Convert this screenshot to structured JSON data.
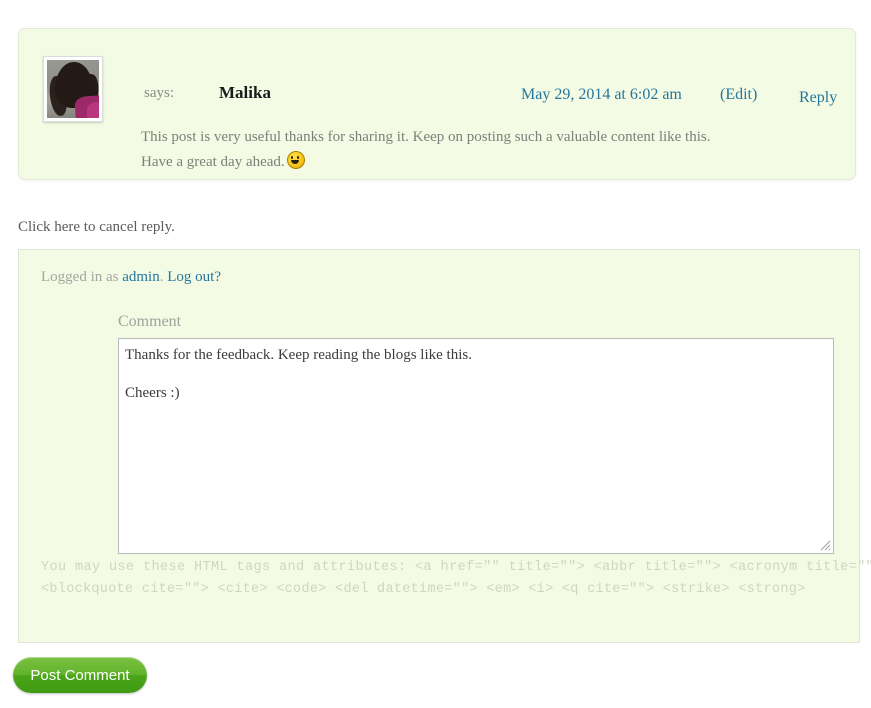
{
  "comment": {
    "says_label": "says:",
    "author": "Malika",
    "date": "May 29, 2014 at 6:02 am",
    "edit_label": "(Edit)",
    "reply_label": "Reply",
    "body_line1": "This post is very useful thanks for sharing it. Keep on posting such a valuable content like this.",
    "body_line2": "Have a great day ahead.",
    "emoji_name": "smiley-face-emoji",
    "avatar_alt": "avatar"
  },
  "cancel_reply": {
    "label": "Click here to cancel reply."
  },
  "respond_form": {
    "logged_in_prefix": "Logged in as",
    "user_name": "admin",
    "separator": ".",
    "logout_label": "Log out?",
    "comment_label": "Comment",
    "comment_value": "Thanks for the feedback. Keep reading the blogs like this.\n\nCheers :)",
    "comment_placeholder": "",
    "allowed_tags_line1": "You may use these HTML tags and attributes: <a  href=\"\"  title=\"\">  <abbr  title=\"\">  <acronym  title=\"\">  <b>",
    "allowed_tags_line2": "<blockquote cite=\"\"> <cite> <code> <del datetime=\"\"> <em> <i> <q cite=\"\"> <strike> <strong>",
    "submit_label": "Post Comment"
  },
  "colors": {
    "panel_background": "#f4fbe4",
    "panel_border": "#dfe5d4",
    "link_blue": "#25769c",
    "muted_text": "#a0a29b",
    "body_text": "#7d7f7a",
    "button_green": "#4aa519",
    "tags_text": "#cfd6c1"
  }
}
